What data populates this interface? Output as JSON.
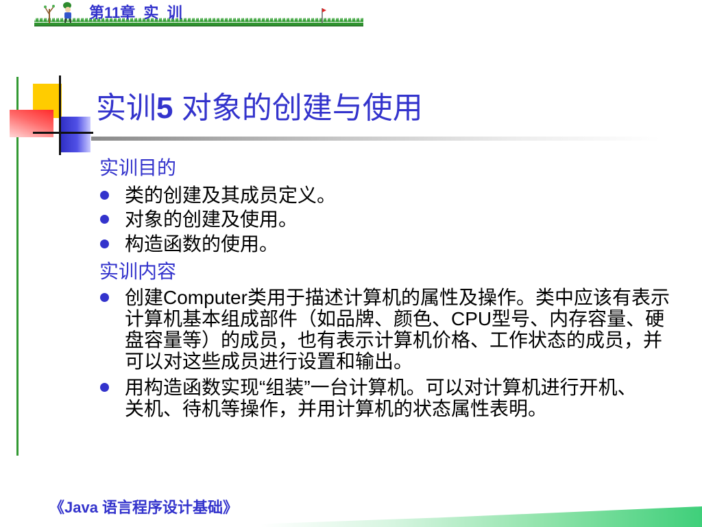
{
  "header": {
    "chapter": "第11章  实  训"
  },
  "title": {
    "prefix": "实训",
    "number": "5",
    "suffix": " 对象的创建与使用"
  },
  "sections": [
    {
      "heading": "实训目的",
      "items": [
        {
          "lines": [
            "类的创建及其成员定义。"
          ]
        },
        {
          "lines": [
            "对象的创建及使用。"
          ]
        },
        {
          "lines": [
            "构造函数的使用。"
          ]
        }
      ]
    },
    {
      "heading": "实训内容",
      "items": [
        {
          "lines": [
            "创建Computer类用于描述计算机的属性及操作。类中应该有表示",
            "计算机基本组成部件（如品牌、颜色、CPU型号、内存容量、硬",
            "盘容量等）的成员，也有表示计算机价格、工作状态的成员，并",
            "可以对这些成员进行设置和输出。"
          ]
        },
        {
          "lines": [
            "用构造函数实现“组装”一台计算机。可以对计算机进行开机、",
            "关机、待机等操作，并用计算机的状态属性表明。"
          ]
        }
      ]
    }
  ],
  "footer": {
    "book_title": "《Java 语言程序设计基础》"
  },
  "icons": {
    "header": [
      "tree-icon",
      "cartoon-figure-icon",
      "flag-icon",
      "grass-strip"
    ],
    "bullet": "filled-circle-bullet-icon"
  },
  "colors": {
    "accent": "#3333cc",
    "green_rule": "#339933",
    "yellow": "#ffcc00",
    "red": "#ff3333",
    "blue": "#3333cc"
  }
}
